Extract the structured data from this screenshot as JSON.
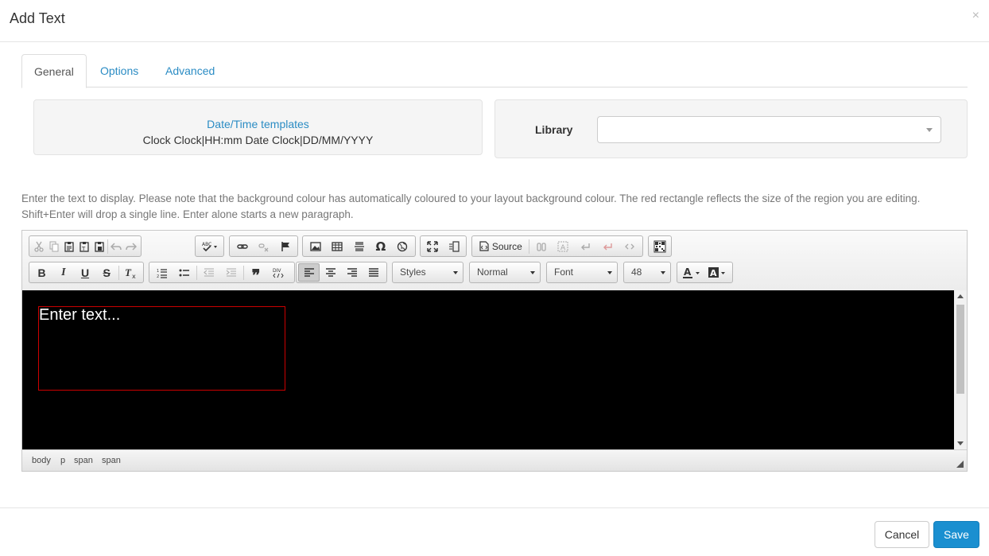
{
  "modal": {
    "title": "Add Text",
    "close_glyph": "×"
  },
  "tabs": [
    {
      "label": "General",
      "active": true
    },
    {
      "label": "Options",
      "active": false
    },
    {
      "label": "Advanced",
      "active": false
    }
  ],
  "templates": {
    "link": "Date/Time templates",
    "items": "Clock Clock|HH:mm Date Clock|DD/MM/YYYY"
  },
  "library": {
    "label": "Library",
    "value": ""
  },
  "help_text": "Enter the text to display. Please note that the background colour has automatically coloured to your layout background colour. The red rectangle reflects the size of the region you are editing. Shift+Enter will drop a single line. Enter alone starts a new paragraph.",
  "toolbar": {
    "source_label": "Source",
    "styles": "Styles",
    "format": "Normal",
    "font": "Font",
    "size": "48"
  },
  "editor": {
    "content": "Enter text...",
    "background": "#000000",
    "region_border_color": "#cc0000",
    "path": [
      "body",
      "p",
      "span",
      "span"
    ]
  },
  "footer": {
    "cancel_label": "Cancel",
    "save_label": "Save"
  },
  "colors": {
    "link": "#2b8cc4",
    "primary": "#1a8fd0"
  }
}
